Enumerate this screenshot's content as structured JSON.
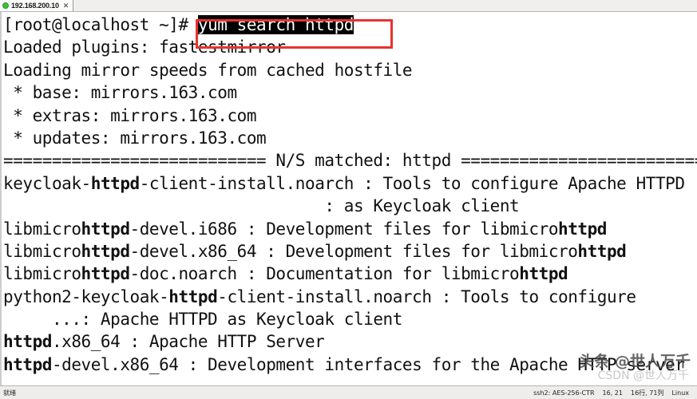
{
  "window": {
    "tab": {
      "status_icon": "green-circle-connected-icon",
      "label": "192.168.200.10",
      "close_label": "✕"
    }
  },
  "terminal": {
    "prompt": "[root@localhost ~]# ",
    "command": "yum search httpd",
    "lines": [
      {
        "id": "prompt-line",
        "segments": [
          {
            "text": "[root@localhost ~]# ",
            "style": "normal"
          },
          {
            "text": "yum search httpd",
            "style": "inverse"
          }
        ]
      },
      {
        "id": "plugins-line",
        "segments": [
          {
            "text": "Loaded plugins: fastestmirror",
            "style": "normal"
          }
        ]
      },
      {
        "id": "mirror-speeds-line",
        "segments": [
          {
            "text": "Loading mirror speeds from cached hostfile",
            "style": "normal"
          }
        ]
      },
      {
        "id": "repo-base-line",
        "segments": [
          {
            "text": " * base: mirrors.163.com",
            "style": "normal"
          }
        ]
      },
      {
        "id": "repo-extras-line",
        "segments": [
          {
            "text": " * extras: mirrors.163.com",
            "style": "normal"
          }
        ]
      },
      {
        "id": "repo-updates-line",
        "segments": [
          {
            "text": " * updates: mirrors.163.com",
            "style": "normal"
          }
        ]
      },
      {
        "id": "ns-matched-separator",
        "segments": [
          {
            "text": "=========================== N/S matched: httpd ============================",
            "style": "normal"
          }
        ]
      },
      {
        "id": "pkg-keycloak-httpd-client-install",
        "segments": [
          {
            "text": "keycloak-",
            "style": "normal"
          },
          {
            "text": "httpd",
            "style": "bold"
          },
          {
            "text": "-client-install.noarch : Tools to configure Apache HTTPD",
            "style": "normal"
          }
        ]
      },
      {
        "id": "pkg-keycloak-cont",
        "segments": [
          {
            "text": "                                 : as Keycloak client",
            "style": "normal"
          }
        ]
      },
      {
        "id": "pkg-libmicrohttpd-devel-i686",
        "segments": [
          {
            "text": "libmicro",
            "style": "normal"
          },
          {
            "text": "httpd",
            "style": "bold"
          },
          {
            "text": "-devel.i686 : Development files for libmicro",
            "style": "normal"
          },
          {
            "text": "httpd",
            "style": "bold"
          }
        ]
      },
      {
        "id": "pkg-libmicrohttpd-devel-x86_64",
        "segments": [
          {
            "text": "libmicro",
            "style": "normal"
          },
          {
            "text": "httpd",
            "style": "bold"
          },
          {
            "text": "-devel.x86_64 : Development files for libmicro",
            "style": "normal"
          },
          {
            "text": "httpd",
            "style": "bold"
          }
        ]
      },
      {
        "id": "pkg-libmicrohttpd-doc",
        "segments": [
          {
            "text": "libmicro",
            "style": "normal"
          },
          {
            "text": "httpd",
            "style": "bold"
          },
          {
            "text": "-doc.noarch : Documentation for libmicro",
            "style": "normal"
          },
          {
            "text": "httpd",
            "style": "bold"
          }
        ]
      },
      {
        "id": "pkg-python2-keycloak-httpd-client-install",
        "segments": [
          {
            "text": "python2-keycloak-",
            "style": "normal"
          },
          {
            "text": "httpd",
            "style": "bold"
          },
          {
            "text": "-client-install.noarch : Tools to configure",
            "style": "normal"
          }
        ]
      },
      {
        "id": "pkg-python2-keycloak-cont",
        "segments": [
          {
            "text": "     ...: Apache HTTPD as Keycloak client",
            "style": "normal"
          }
        ]
      },
      {
        "id": "pkg-httpd-x86_64",
        "segments": [
          {
            "text": "httpd",
            "style": "bold"
          },
          {
            "text": ".x86_64 : Apache HTTP Server",
            "style": "normal"
          }
        ]
      },
      {
        "id": "pkg-httpd-devel-x86_64",
        "segments": [
          {
            "text": "httpd",
            "style": "bold"
          },
          {
            "text": "-devel.x86_64 : Development interfaces for the Apache HTTP server",
            "style": "normal"
          }
        ]
      }
    ]
  },
  "annotation": {
    "type": "red-rectangle-highlight",
    "color": "#e8332f",
    "targets": "yum search httpd"
  },
  "watermark": {
    "main": "头条 @世人万千",
    "sub": "CSDN @世人万千"
  },
  "statusbar": {
    "left": "就绪",
    "encryption": "ssh2: AES-256-CTR",
    "cursor": "16, 21",
    "dimensions": "16行, 71列",
    "terminal_type": "Linux"
  }
}
